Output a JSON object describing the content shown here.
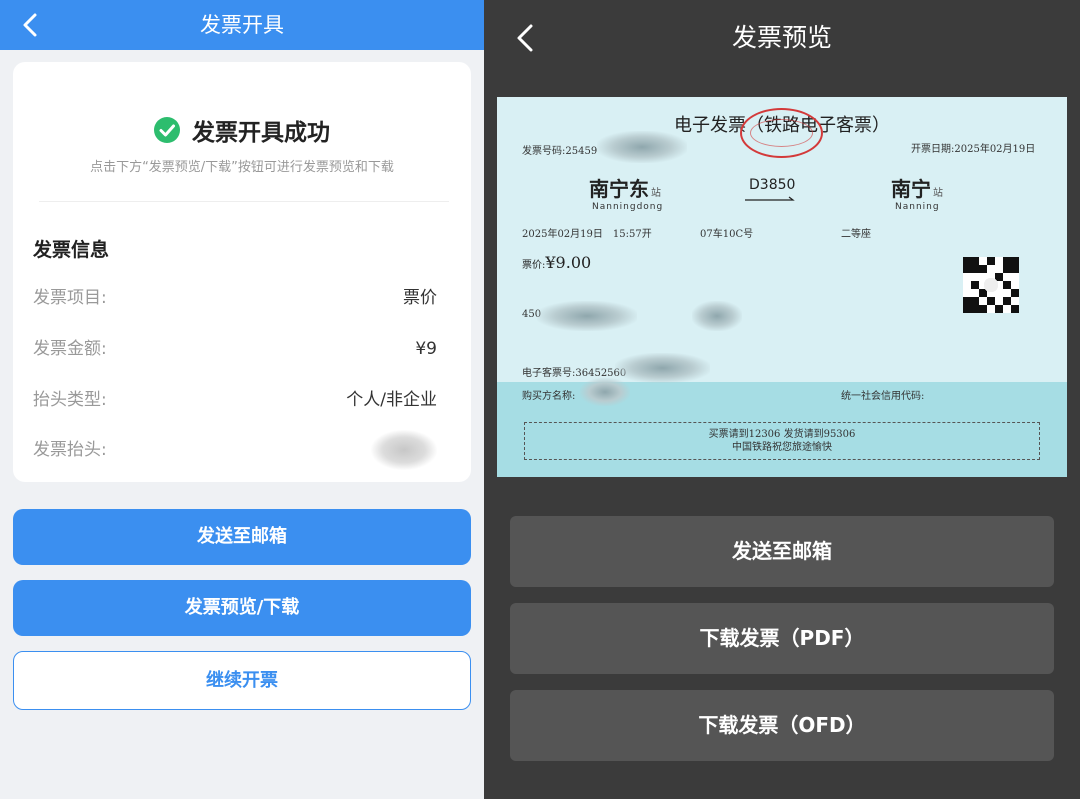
{
  "left": {
    "header": {
      "title": "发票开具"
    },
    "success": {
      "title": "发票开具成功",
      "hint": "点击下方“发票预览/下载”按钮可进行发票预览和下载"
    },
    "info": {
      "section_title": "发票信息",
      "rows": [
        {
          "label": "发票项目:",
          "value": "票价"
        },
        {
          "label": "发票金额:",
          "value": "¥9"
        },
        {
          "label": "抬头类型:",
          "value": "个人/非企业"
        },
        {
          "label": "发票抬头:",
          "value": ""
        }
      ]
    },
    "buttons": {
      "send_email": "发送至邮箱",
      "preview_download": "发票预览/下载",
      "continue": "继续开票"
    }
  },
  "right": {
    "header": {
      "title": "发票预览"
    },
    "ticket": {
      "title": "电子发票（铁路电子客票）",
      "invoice_no_label": "发票号码:25459",
      "issue_date": "开票日期:2025年02月19日",
      "from_station": "南宁东",
      "from_pinyin": "Nanningdong",
      "to_station": "南宁",
      "to_pinyin": "Nanning",
      "station_suffix": "站",
      "train_no": "D3850",
      "depart": "2025年02月19日　15:57开",
      "seat": "07车10C号",
      "seat_class": "二等座",
      "price_label": "票价:",
      "price_value": "¥9.00",
      "id_prefix": "450",
      "eticket_no": "电子客票号:36452560",
      "buyer_label": "购买方名称:",
      "credit_code_label": "统一社会信用代码:",
      "footer_line1": "买票请到12306 发货请到95306",
      "footer_line2": "中国铁路祝您旅途愉快"
    },
    "buttons": {
      "send_email": "发送至邮箱",
      "download_pdf": "下载发票（PDF）",
      "download_ofd": "下载发票（OFD）"
    }
  },
  "colors": {
    "primary_blue": "#3b8ff0",
    "success_green": "#2dbd6e",
    "dark_bg": "#3b3b3b",
    "dark_button": "#555555",
    "ticket_bg": "#d9f0f4",
    "stamp_red": "#d33a3a"
  },
  "icons": {
    "back": "chevron-left-icon",
    "success": "check-circle-icon",
    "qr": "qr-code-icon"
  }
}
